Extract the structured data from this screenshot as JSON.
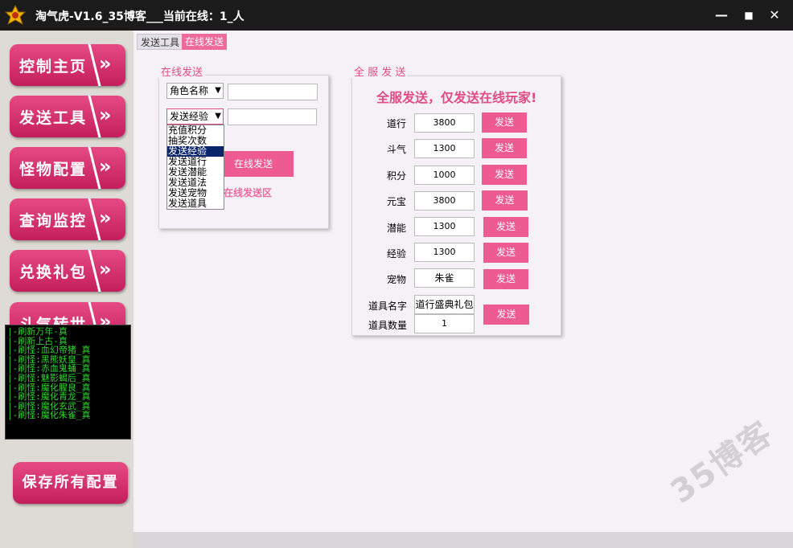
{
  "window": {
    "title": "淘气虎-V1.6_35博客___当前在线：1_人",
    "minimize": "—",
    "maximize": "■",
    "close": "✕"
  },
  "sidebar": {
    "items": [
      {
        "label": "控制主页",
        "chevron": "»"
      },
      {
        "label": "发送工具",
        "chevron": "»"
      },
      {
        "label": "怪物配置",
        "chevron": "»"
      },
      {
        "label": "查询监控",
        "chevron": "»"
      },
      {
        "label": "兑换礼包",
        "chevron": "»"
      },
      {
        "label": "斗气转世",
        "chevron": "»"
      }
    ],
    "log": [
      "|-刷新万年-真",
      "|-刷新上古-真",
      "|-刷怪:血幻帝猪_真",
      "|-刷怪:黑熊妖皇_真",
      "|-刷怪:赤血鬼蛹_真",
      "|-刷怪:魅影蝎后_真",
      "|-刷怪:魔化腥良_真",
      "|-刷怪:魔化青龙_真",
      "|-刷怪:魔化玄武_真",
      "|-刷怪:魔化朱雀_真"
    ],
    "save_label": "保存所有配置"
  },
  "tabs": [
    "发送工具",
    "在线发送"
  ],
  "online_send": {
    "group_title": "在线发送",
    "target_select": "角色名称",
    "target_value": "",
    "type_select": "发送经验",
    "type_value": "",
    "options": [
      "充值积分",
      "抽奖次数",
      "发送经验",
      "发送道行",
      "发送潜能",
      "发送道法",
      "发送宠物",
      "发送道具"
    ],
    "selected_index": 2,
    "send_button": "在线发送",
    "area_label": "在线发送区"
  },
  "broadcast": {
    "group_title": "全 服 发 送",
    "title": "全服发送，仅发送在线玩家!",
    "rows": [
      {
        "label": "道行",
        "value": "3800",
        "button": "发送"
      },
      {
        "label": "斗气",
        "value": "1300",
        "button": "发送"
      },
      {
        "label": "积分",
        "value": "1000",
        "button": "发送"
      },
      {
        "label": "元宝",
        "value": "3800",
        "button": "发送"
      },
      {
        "label": "潜能",
        "value": "1300",
        "button": "发送"
      },
      {
        "label": "经验",
        "value": "1300",
        "button": "发送"
      },
      {
        "label": "宠物",
        "value": "朱雀",
        "button": "发送"
      }
    ],
    "item_name_label": "道具名字",
    "item_name_value": "道行盛典礼包",
    "item_qty_label": "道具数量",
    "item_qty_value": "1",
    "item_button": "发送"
  },
  "watermark": "35博客"
}
